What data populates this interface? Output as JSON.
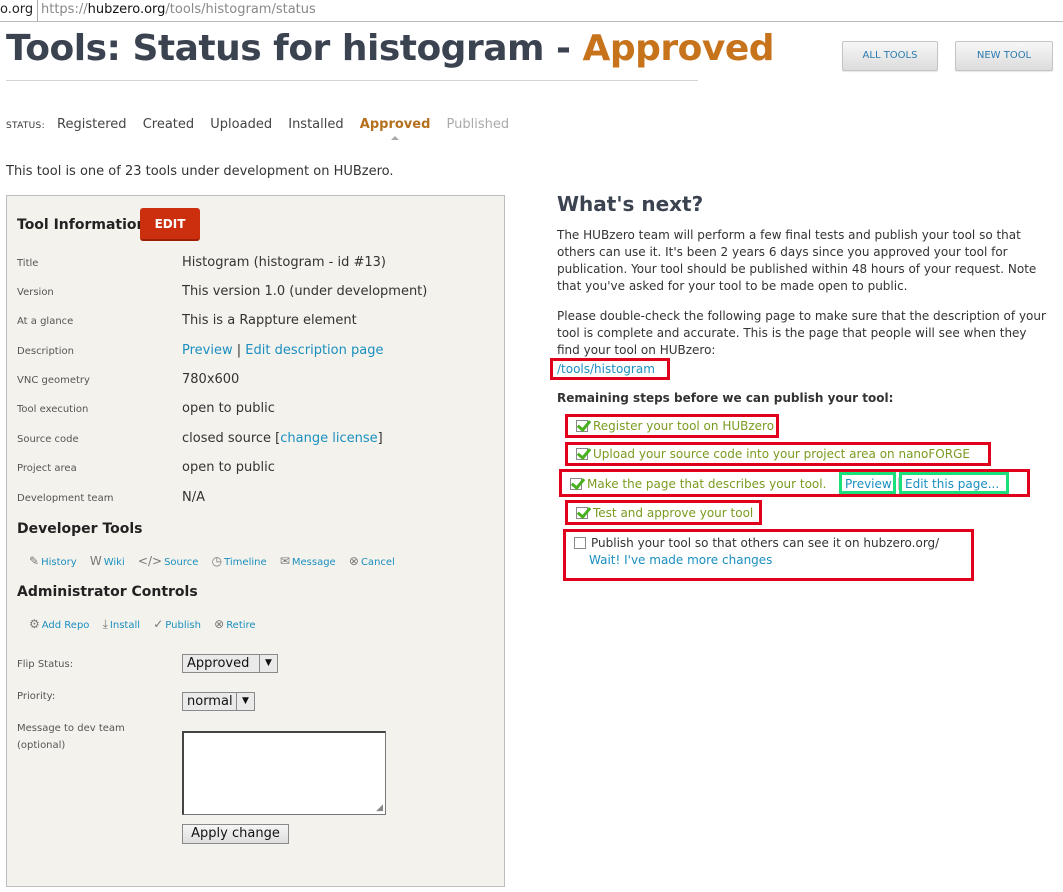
{
  "browser": {
    "prev_tab_text": "o.org",
    "url_prefix": "https://",
    "url_host": "hubzero.org",
    "url_path": "/tools/histogram/status"
  },
  "header": {
    "title_prefix": "Tools: Status for histogram - ",
    "title_status": "Approved",
    "buttons": {
      "all_tools": "ALL TOOLS",
      "new_tool": "NEW TOOL"
    }
  },
  "status_bar": {
    "label": "STATUS:",
    "stages": [
      "Registered",
      "Created",
      "Uploaded",
      "Installed",
      "Approved",
      "Published"
    ],
    "active": "Approved"
  },
  "intro": "This tool is one of 23 tools under development on HUBzero.",
  "tool_info": {
    "heading": "Tool Information",
    "edit_label": "EDIT",
    "rows": [
      {
        "key": "Title",
        "value": "Histogram (histogram - id #13)"
      },
      {
        "key": "Version",
        "value": "This version 1.0 (under development)"
      },
      {
        "key": "At a glance",
        "value": "This is a Rappture element"
      },
      {
        "key": "Description",
        "link1": "Preview",
        "sep": " | ",
        "link2": "Edit description page"
      },
      {
        "key": "VNC geometry",
        "value": "780x600"
      },
      {
        "key": "Tool execution",
        "value": "open to public"
      },
      {
        "key": "Source code",
        "value": "closed source [",
        "link": "change license",
        "suffix": "]"
      },
      {
        "key": "Project area",
        "value": "open to public"
      },
      {
        "key": "Development team",
        "value": "N/A"
      }
    ]
  },
  "developer_tools": {
    "heading": "Developer Tools",
    "items": [
      "History",
      "Wiki",
      "Source",
      "Timeline",
      "Message",
      "Cancel"
    ]
  },
  "admin_controls": {
    "heading": "Administrator Controls",
    "items": [
      "Add Repo",
      "Install",
      "Publish",
      "Retire"
    ],
    "flip_status_label": "Flip Status:",
    "flip_status_value": "Approved",
    "priority_label": "Priority:",
    "priority_value": "normal",
    "message_label_1": "Message to dev team",
    "message_label_2": "(optional)",
    "apply_label": "Apply change"
  },
  "whats_next": {
    "heading": "What's next?",
    "para1": "The HUBzero team will perform a few final tests and publish your tool so that others can use it. It's been 2 years 6 days since you approved your tool for publication. Your tool should be published within 48 hours of your request. Note that you've asked for your tool to be made open to public.",
    "para2": "Please double-check the following page to make sure that the description of your tool is complete and accurate. This is the page that people will see when they find your tool on HUBzero:",
    "page_link": "/tools/histogram",
    "remaining_heading": "Remaining steps before we can publish your tool:",
    "steps": [
      "Register your tool on HUBzero",
      "Upload your source code into your project area on nanoFORGE",
      "Make the page that describes your tool.",
      "Test and approve your tool"
    ],
    "step3_preview": "Preview",
    "step3_sep": "|",
    "step3_edit": "Edit this page...",
    "publish_step": "Publish your tool so that others can see it on hubzero.org/",
    "wait_link": "Wait! I've made more changes"
  }
}
